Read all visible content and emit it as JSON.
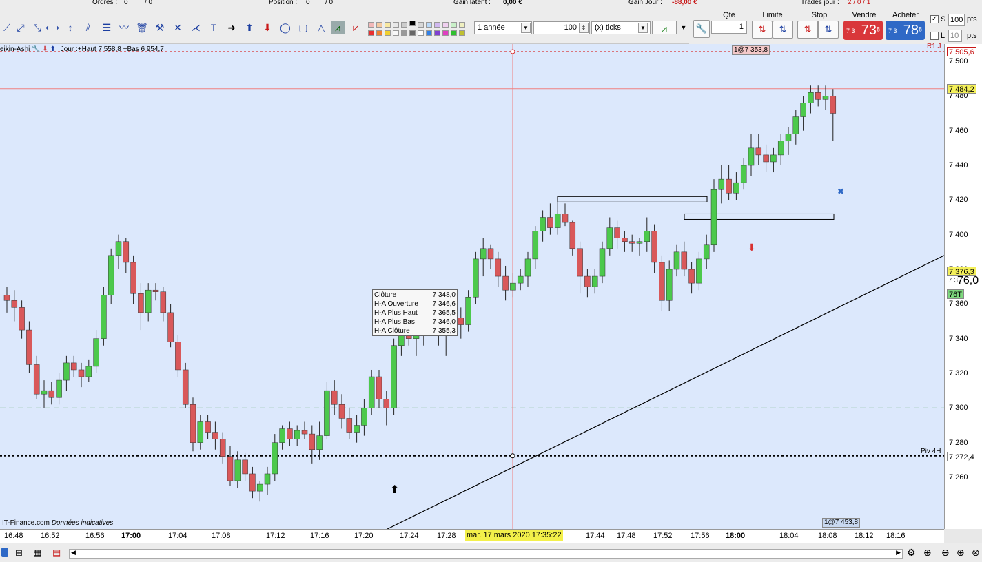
{
  "statusbar": {
    "ordres_label": "Ordres :",
    "ordres_value": "0",
    "ordres_slash": "/ 0",
    "position_label": "Position :",
    "position_value": "0",
    "position_slash": "/ 0",
    "gain_latent_label": "Gain latent :",
    "gain_latent_value": "0,00 €",
    "gain_jour_label": "Gain Jour :",
    "gain_jour_value": "-88,00 €",
    "trades_label": "Trades jour :",
    "trades_value": "2 / 0 / 1"
  },
  "toolbar": {
    "period_value": "1 année",
    "units_value": "100",
    "ticks_value": "(x) ticks"
  },
  "order_panel": {
    "qty_label": "Qté",
    "qty_value": "1",
    "limit_label": "Limite",
    "stop_label": "Stop",
    "sell_label": "Vendre",
    "sell_prefix": "7 3",
    "sell_price": "73",
    "sell_decimal": "8",
    "buy_label": "Acheter",
    "buy_prefix": "7 3",
    "buy_price": "78",
    "buy_decimal": "8",
    "s_label": "S",
    "s_value": "100",
    "s_unit": "pts",
    "l_label": "L",
    "l_value": "10",
    "l_unit": "pts"
  },
  "chart": {
    "legend": "eikin-Ashi",
    "legend_info": "Jour :+Haut 7 558,8 +Bas 6 954,7",
    "r1_label": "R1 J",
    "piv_label": "Piv 4H",
    "trade_tag_top": "1@7 353,8",
    "trade_tag_bottom": "1@7 453,8",
    "footnote_source": "IT-Finance.com",
    "footnote_note": "Données indicatives",
    "cursor_date": "mar. 17 mars 2020 17:35:22",
    "data_panel": [
      {
        "label": "Clôture",
        "value": "7 348,0"
      },
      {
        "label": "H-A Ouverture",
        "value": "7 346,6"
      },
      {
        "label": "H-A Plus Haut",
        "value": "7 365,5"
      },
      {
        "label": "H-A Plus Bas",
        "value": "7 346,0"
      },
      {
        "label": "H-A Clôture",
        "value": "7 355,3"
      }
    ]
  },
  "yaxis": {
    "ticks": [
      "7 500",
      "7 480",
      "7 460",
      "7 440",
      "7 420",
      "7 400",
      "7 380",
      "7 360",
      "7 340",
      "7 320",
      "7 300",
      "7 280",
      "7 260"
    ],
    "tag_r1": "7 505,6",
    "tag_high": "7 484,2",
    "tag_last": "7 376,3",
    "tag_cursor": "76,0",
    "tag_cursor_prefix": "7 3",
    "tag_76t": "76T",
    "tag_piv": "7 272,4"
  },
  "xaxis": {
    "ticks": [
      "16:48",
      "16:52",
      "16:56",
      "17:00",
      "17:04",
      "17:08",
      "17:12",
      "17:16",
      "17:20",
      "17:24",
      "17:28",
      "17:44",
      "17:48",
      "17:52",
      "17:56",
      "18:00",
      "18:04",
      "18:08",
      "18:12",
      "18:16"
    ]
  },
  "chart_data": {
    "type": "candlestick",
    "title": "",
    "ylim": [
      7240,
      7510
    ],
    "up_color": "#4cc94c",
    "down_color": "#d9585a",
    "levels": {
      "r1": 7505.6,
      "high": 7484.2,
      "piv": 7272.4,
      "green_dashed": 7300
    },
    "candles": [
      {
        "o": 7365,
        "h": 7370,
        "l": 7355,
        "c": 7362
      },
      {
        "o": 7362,
        "h": 7368,
        "l": 7350,
        "c": 7358
      },
      {
        "o": 7358,
        "h": 7362,
        "l": 7340,
        "c": 7345
      },
      {
        "o": 7345,
        "h": 7350,
        "l": 7320,
        "c": 7325
      },
      {
        "o": 7325,
        "h": 7330,
        "l": 7305,
        "c": 7308
      },
      {
        "o": 7308,
        "h": 7316,
        "l": 7300,
        "c": 7310
      },
      {
        "o": 7310,
        "h": 7315,
        "l": 7302,
        "c": 7306
      },
      {
        "o": 7306,
        "h": 7320,
        "l": 7302,
        "c": 7316
      },
      {
        "o": 7316,
        "h": 7330,
        "l": 7310,
        "c": 7326
      },
      {
        "o": 7326,
        "h": 7330,
        "l": 7318,
        "c": 7322
      },
      {
        "o": 7322,
        "h": 7326,
        "l": 7312,
        "c": 7318
      },
      {
        "o": 7318,
        "h": 7328,
        "l": 7315,
        "c": 7324
      },
      {
        "o": 7324,
        "h": 7345,
        "l": 7320,
        "c": 7340
      },
      {
        "o": 7340,
        "h": 7370,
        "l": 7336,
        "c": 7365
      },
      {
        "o": 7365,
        "h": 7392,
        "l": 7360,
        "c": 7388
      },
      {
        "o": 7388,
        "h": 7400,
        "l": 7380,
        "c": 7396
      },
      {
        "o": 7396,
        "h": 7398,
        "l": 7378,
        "c": 7384
      },
      {
        "o": 7384,
        "h": 7388,
        "l": 7360,
        "c": 7366
      },
      {
        "o": 7366,
        "h": 7372,
        "l": 7345,
        "c": 7355
      },
      {
        "o": 7355,
        "h": 7372,
        "l": 7350,
        "c": 7368
      },
      {
        "o": 7368,
        "h": 7372,
        "l": 7362,
        "c": 7367
      },
      {
        "o": 7367,
        "h": 7370,
        "l": 7350,
        "c": 7355
      },
      {
        "o": 7355,
        "h": 7360,
        "l": 7335,
        "c": 7338
      },
      {
        "o": 7338,
        "h": 7342,
        "l": 7318,
        "c": 7322
      },
      {
        "o": 7322,
        "h": 7326,
        "l": 7300,
        "c": 7302
      },
      {
        "o": 7302,
        "h": 7306,
        "l": 7275,
        "c": 7280
      },
      {
        "o": 7280,
        "h": 7296,
        "l": 7276,
        "c": 7292
      },
      {
        "o": 7292,
        "h": 7296,
        "l": 7282,
        "c": 7286
      },
      {
        "o": 7286,
        "h": 7292,
        "l": 7276,
        "c": 7282
      },
      {
        "o": 7282,
        "h": 7286,
        "l": 7268,
        "c": 7272
      },
      {
        "o": 7272,
        "h": 7278,
        "l": 7255,
        "c": 7258
      },
      {
        "o": 7258,
        "h": 7275,
        "l": 7254,
        "c": 7270
      },
      {
        "o": 7270,
        "h": 7274,
        "l": 7258,
        "c": 7262
      },
      {
        "o": 7262,
        "h": 7266,
        "l": 7248,
        "c": 7252
      },
      {
        "o": 7252,
        "h": 7258,
        "l": 7246,
        "c": 7256
      },
      {
        "o": 7256,
        "h": 7266,
        "l": 7250,
        "c": 7262
      },
      {
        "o": 7262,
        "h": 7285,
        "l": 7258,
        "c": 7280
      },
      {
        "o": 7280,
        "h": 7290,
        "l": 7276,
        "c": 7288
      },
      {
        "o": 7288,
        "h": 7292,
        "l": 7278,
        "c": 7282
      },
      {
        "o": 7282,
        "h": 7290,
        "l": 7278,
        "c": 7287
      },
      {
        "o": 7287,
        "h": 7292,
        "l": 7282,
        "c": 7285
      },
      {
        "o": 7285,
        "h": 7290,
        "l": 7268,
        "c": 7276
      },
      {
        "o": 7276,
        "h": 7292,
        "l": 7270,
        "c": 7284
      },
      {
        "o": 7284,
        "h": 7315,
        "l": 7282,
        "c": 7310
      },
      {
        "o": 7310,
        "h": 7316,
        "l": 7296,
        "c": 7302
      },
      {
        "o": 7302,
        "h": 7308,
        "l": 7288,
        "c": 7294
      },
      {
        "o": 7294,
        "h": 7300,
        "l": 7282,
        "c": 7286
      },
      {
        "o": 7286,
        "h": 7296,
        "l": 7280,
        "c": 7290
      },
      {
        "o": 7290,
        "h": 7305,
        "l": 7284,
        "c": 7300
      },
      {
        "o": 7300,
        "h": 7322,
        "l": 7296,
        "c": 7318
      },
      {
        "o": 7318,
        "h": 7322,
        "l": 7300,
        "c": 7305
      },
      {
        "o": 7305,
        "h": 7310,
        "l": 7290,
        "c": 7300
      },
      {
        "o": 7300,
        "h": 7340,
        "l": 7296,
        "c": 7336
      },
      {
        "o": 7336,
        "h": 7356,
        "l": 7330,
        "c": 7352
      },
      {
        "o": 7352,
        "h": 7360,
        "l": 7336,
        "c": 7340
      },
      {
        "o": 7340,
        "h": 7348,
        "l": 7330,
        "c": 7346
      },
      {
        "o": 7346,
        "h": 7362,
        "l": 7336,
        "c": 7355
      },
      {
        "o": 7355,
        "h": 7366,
        "l": 7346,
        "c": 7358
      },
      {
        "o": 7358,
        "h": 7362,
        "l": 7336,
        "c": 7344
      },
      {
        "o": 7344,
        "h": 7352,
        "l": 7330,
        "c": 7348
      },
      {
        "o": 7348,
        "h": 7358,
        "l": 7342,
        "c": 7352
      },
      {
        "o": 7352,
        "h": 7358,
        "l": 7340,
        "c": 7348
      },
      {
        "o": 7348,
        "h": 7368,
        "l": 7344,
        "c": 7364
      },
      {
        "o": 7364,
        "h": 7390,
        "l": 7360,
        "c": 7386
      },
      {
        "o": 7386,
        "h": 7398,
        "l": 7376,
        "c": 7392
      },
      {
        "o": 7392,
        "h": 7394,
        "l": 7380,
        "c": 7386
      },
      {
        "o": 7386,
        "h": 7390,
        "l": 7370,
        "c": 7376
      },
      {
        "o": 7376,
        "h": 7382,
        "l": 7362,
        "c": 7368
      },
      {
        "o": 7368,
        "h": 7378,
        "l": 7364,
        "c": 7372
      },
      {
        "o": 7372,
        "h": 7380,
        "l": 7368,
        "c": 7376
      },
      {
        "o": 7376,
        "h": 7390,
        "l": 7370,
        "c": 7386
      },
      {
        "o": 7386,
        "h": 7405,
        "l": 7380,
        "c": 7402
      },
      {
        "o": 7402,
        "h": 7414,
        "l": 7396,
        "c": 7410
      },
      {
        "o": 7410,
        "h": 7418,
        "l": 7400,
        "c": 7404
      },
      {
        "o": 7404,
        "h": 7420,
        "l": 7400,
        "c": 7412
      },
      {
        "o": 7412,
        "h": 7418,
        "l": 7405,
        "c": 7407
      },
      {
        "o": 7407,
        "h": 7408,
        "l": 7388,
        "c": 7392
      },
      {
        "o": 7392,
        "h": 7396,
        "l": 7366,
        "c": 7376
      },
      {
        "o": 7376,
        "h": 7380,
        "l": 7364,
        "c": 7370
      },
      {
        "o": 7370,
        "h": 7380,
        "l": 7366,
        "c": 7376
      },
      {
        "o": 7376,
        "h": 7396,
        "l": 7372,
        "c": 7392
      },
      {
        "o": 7392,
        "h": 7410,
        "l": 7388,
        "c": 7404
      },
      {
        "o": 7404,
        "h": 7408,
        "l": 7392,
        "c": 7398
      },
      {
        "o": 7398,
        "h": 7402,
        "l": 7390,
        "c": 7396
      },
      {
        "o": 7396,
        "h": 7400,
        "l": 7390,
        "c": 7395
      },
      {
        "o": 7395,
        "h": 7398,
        "l": 7388,
        "c": 7396
      },
      {
        "o": 7396,
        "h": 7410,
        "l": 7390,
        "c": 7402
      },
      {
        "o": 7402,
        "h": 7406,
        "l": 7378,
        "c": 7384
      },
      {
        "o": 7384,
        "h": 7388,
        "l": 7356,
        "c": 7362
      },
      {
        "o": 7362,
        "h": 7385,
        "l": 7356,
        "c": 7380
      },
      {
        "o": 7380,
        "h": 7394,
        "l": 7376,
        "c": 7390
      },
      {
        "o": 7390,
        "h": 7396,
        "l": 7376,
        "c": 7380
      },
      {
        "o": 7380,
        "h": 7384,
        "l": 7366,
        "c": 7372
      },
      {
        "o": 7372,
        "h": 7390,
        "l": 7368,
        "c": 7386
      },
      {
        "o": 7386,
        "h": 7400,
        "l": 7380,
        "c": 7394
      },
      {
        "o": 7394,
        "h": 7432,
        "l": 7390,
        "c": 7426
      },
      {
        "o": 7426,
        "h": 7440,
        "l": 7418,
        "c": 7432
      },
      {
        "o": 7432,
        "h": 7440,
        "l": 7420,
        "c": 7424
      },
      {
        "o": 7424,
        "h": 7436,
        "l": 7420,
        "c": 7430
      },
      {
        "o": 7430,
        "h": 7444,
        "l": 7426,
        "c": 7440
      },
      {
        "o": 7440,
        "h": 7458,
        "l": 7434,
        "c": 7450
      },
      {
        "o": 7450,
        "h": 7458,
        "l": 7440,
        "c": 7446
      },
      {
        "o": 7446,
        "h": 7452,
        "l": 7436,
        "c": 7442
      },
      {
        "o": 7442,
        "h": 7450,
        "l": 7436,
        "c": 7446
      },
      {
        "o": 7446,
        "h": 7458,
        "l": 7440,
        "c": 7454
      },
      {
        "o": 7454,
        "h": 7462,
        "l": 7446,
        "c": 7458
      },
      {
        "o": 7458,
        "h": 7472,
        "l": 7452,
        "c": 7468
      },
      {
        "o": 7468,
        "h": 7480,
        "l": 7460,
        "c": 7476
      },
      {
        "o": 7476,
        "h": 7486,
        "l": 7470,
        "c": 7482
      },
      {
        "o": 7482,
        "h": 7486,
        "l": 7474,
        "c": 7478
      },
      {
        "o": 7478,
        "h": 7486,
        "l": 7472,
        "c": 7480
      },
      {
        "o": 7480,
        "h": 7484,
        "l": 7454,
        "c": 7470
      }
    ],
    "boxes": [
      {
        "time_from_candle": 96,
        "time_to_candle": 113,
        "price_low": 7418,
        "price_high": 7422
      },
      {
        "time_from_candle": 113,
        "time_to_candle": 131,
        "price_low": 7408,
        "price_high": 7412
      }
    ],
    "trendline": {
      "from": {
        "candle": 57,
        "price": 7250
      },
      "to": {
        "candle": 160,
        "price": 7388
      }
    }
  }
}
